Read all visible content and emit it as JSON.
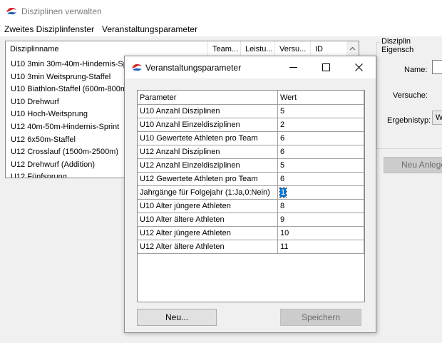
{
  "main_window": {
    "title": "Disziplinen verwalten",
    "icon": "app-logo-icon",
    "menu": [
      "Zweites Disziplinfenster",
      "Veranstaltungsparameter"
    ]
  },
  "discipline_list": {
    "columns": [
      "Disziplinname",
      "Team...",
      "Leistu...",
      "Versu...",
      "ID"
    ],
    "rows": [
      "U10 3min 30m-40m-Hindernis-Sprint",
      "U10 3min Weitsprung-Staffel",
      "U10 Biathlon-Staffel (600m-800m)",
      "U10 Drehwurf",
      "U10 Hoch-Weitsprung",
      "U12 40m-50m-Hindernis-Sprint",
      "U12 6x50m-Staffel",
      "U12 Crosslauf (1500m-2500m)",
      "U12 Drehwurf (Addition)",
      "U12 Fünfsprung"
    ]
  },
  "right_panel": {
    "group_title": "Disziplin Eigensch",
    "name_label": "Name:",
    "attempts_label": "Versuche:",
    "result_type_label": "Ergebnistyp:",
    "result_type_value": "W",
    "new_button": "Neu Anlege"
  },
  "dialog": {
    "title": "Veranstaltungsparameter",
    "icon": "app-logo-icon",
    "columns": [
      "Parameter",
      "Wert"
    ],
    "rows": [
      {
        "parameter": "U10 Anzahl Disziplinen",
        "value": "5"
      },
      {
        "parameter": "U10 Anzahl Einzeldisziplinen",
        "value": "2"
      },
      {
        "parameter": "U10 Gewertete Athleten pro Team",
        "value": "6"
      },
      {
        "parameter": "U12 Anzahl Disziplinen",
        "value": "6"
      },
      {
        "parameter": "U12 Anzahl Einzeldisziplinen",
        "value": "5"
      },
      {
        "parameter": "U12 Gewertete Athleten pro Team",
        "value": "6"
      },
      {
        "parameter": "Jahrgänge für Folgejahr (1:Ja,0:Nein)",
        "value": "1"
      },
      {
        "parameter": "U10 Alter jüngere Athleten",
        "value": "8"
      },
      {
        "parameter": "U10 Alter ältere Athleten",
        "value": "9"
      },
      {
        "parameter": "U12 Alter jüngere Athleten",
        "value": "10"
      },
      {
        "parameter": "U12 Alter ältere Athleten",
        "value": "11"
      }
    ],
    "selected_row": 6,
    "buttons": {
      "new": "Neu...",
      "save": "Speichern"
    }
  },
  "colors": {
    "selection": "#0078d7",
    "logo_red": "#d8232a"
  }
}
